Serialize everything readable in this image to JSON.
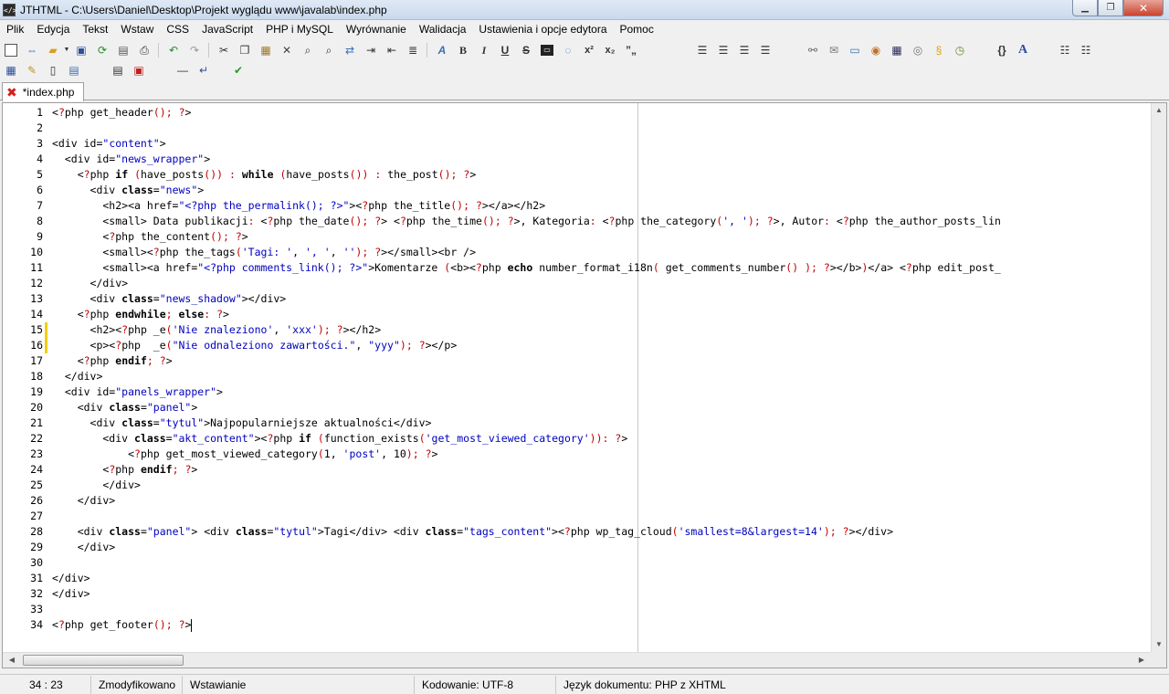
{
  "window": {
    "title": "JTHTML - C:\\Users\\Daniel\\Desktop\\Projekt wyglądu www\\javalab\\index.php",
    "app_icon_text": "</>"
  },
  "menu": [
    "Plik",
    "Edycja",
    "Tekst",
    "Wstaw",
    "CSS",
    "JavaScript",
    "PHP i MySQL",
    "Wyrównanie",
    "Walidacja",
    "Ustawienia i opcje edytora",
    "Pomoc"
  ],
  "toolbar1": {
    "file_icons": [
      "new-file-icon",
      "open-html-icon",
      "open-folder-icon",
      "save-icon",
      "save-all-icon",
      "refresh-icon",
      "print-icon"
    ],
    "undo_icons": [
      "undo-icon",
      "redo-icon"
    ],
    "edit_icons": [
      "cut-icon",
      "copy-icon",
      "paste-icon",
      "delete-icon",
      "find-icon",
      "find-next-icon",
      "replace-icon",
      "indent-icon",
      "outdent-icon",
      "comment-icon"
    ],
    "format_labels": {
      "bold": "B",
      "italic": "I",
      "underline": "U",
      "strike": "S",
      "superscript": "x²",
      "subscript": "x₂",
      "quote": "”„"
    },
    "align_icons": [
      "align-left-icon",
      "align-center-icon",
      "align-right-icon",
      "justify-icon"
    ],
    "insert_icons": [
      "link-icon",
      "email-icon",
      "image-icon",
      "palette-icon",
      "table-icon",
      "media-icon",
      "plugin-icon",
      "clock-icon"
    ],
    "braces_label": "{}",
    "font_label": "A"
  },
  "toolbar2": {
    "icons": [
      "table-grid-icon",
      "edit-table-icon",
      "frame-icon",
      "form-icon",
      "list-icon",
      "validate-icon",
      "hr-icon",
      "line-break-icon",
      "check-icon"
    ]
  },
  "tab": {
    "label": "*index.php"
  },
  "code_lines": [
    {
      "n": "1",
      "text": "<?php get_header(); ?>"
    },
    {
      "n": "2",
      "text": ""
    },
    {
      "n": "3",
      "text": "<div id=\"content\">"
    },
    {
      "n": "4",
      "text": "  <div id=\"news_wrapper\">"
    },
    {
      "n": "5",
      "text": "    <?php if (have_posts()) : while (have_posts()) : the_post(); ?>"
    },
    {
      "n": "6",
      "text": "      <div class=\"news\">"
    },
    {
      "n": "7",
      "text": "        <h2><a href=\"<?php the_permalink(); ?>\"><?php the_title(); ?></a></h2>"
    },
    {
      "n": "8",
      "text": "        <small> Data publikacji: <?php the_date(); ?> <?php the_time(); ?>, Kategoria: <?php the_category(', '); ?>, Autor: <?php the_author_posts_lin"
    },
    {
      "n": "9",
      "text": "        <?php the_content(); ?>"
    },
    {
      "n": "10",
      "text": "        <small><?php the_tags('Tagi: ', ', ', ''); ?></small><br />"
    },
    {
      "n": "11",
      "text": "        <small><a href=\"<?php comments_link(); ?>\">Komentarze (<b><?php echo number_format_i18n( get_comments_number() ); ?></b>)</a> <?php edit_post_"
    },
    {
      "n": "12",
      "text": "      </div>"
    },
    {
      "n": "13",
      "text": "      <div class=\"news_shadow\"></div>"
    },
    {
      "n": "14",
      "text": "    <?php endwhile; else: ?>"
    },
    {
      "n": "15",
      "text": "      <h2><?php _e('Nie znaleziono', 'xxx'); ?></h2>"
    },
    {
      "n": "16",
      "text": "      <p><?php  _e(\"Nie odnaleziono zawartości.\", \"yyy\"); ?></p>"
    },
    {
      "n": "17",
      "text": "    <?php endif; ?>"
    },
    {
      "n": "18",
      "text": "  </div>"
    },
    {
      "n": "19",
      "text": "  <div id=\"panels_wrapper\">"
    },
    {
      "n": "20",
      "text": "    <div class=\"panel\">"
    },
    {
      "n": "21",
      "text": "      <div class=\"tytul\">Najpopularniejsze aktualności</div>"
    },
    {
      "n": "22",
      "text": "        <div class=\"akt_content\"><?php if (function_exists('get_most_viewed_category')): ?>"
    },
    {
      "n": "23",
      "text": "            <?php get_most_viewed_category(1, 'post', 10); ?>"
    },
    {
      "n": "24",
      "text": "        <?php endif; ?>"
    },
    {
      "n": "25",
      "text": "        </div>"
    },
    {
      "n": "26",
      "text": "    </div>"
    },
    {
      "n": "27",
      "text": ""
    },
    {
      "n": "28",
      "text": "    <div class=\"panel\"> <div class=\"tytul\">Tagi</div> <div class=\"tags_content\"><?php wp_tag_cloud('smallest=8&largest=14'); ?></div>"
    },
    {
      "n": "29",
      "text": "    </div>"
    },
    {
      "n": "30",
      "text": ""
    },
    {
      "n": "31",
      "text": "</div>"
    },
    {
      "n": "32",
      "text": "</div>"
    },
    {
      "n": "33",
      "text": ""
    },
    {
      "n": "34",
      "text": "<?php get_footer(); ?>"
    }
  ],
  "modified_lines": [
    "15",
    "16"
  ],
  "status": {
    "position": "34 : 23",
    "modified": "Zmodyfikowano",
    "mode": "Wstawianie",
    "encoding": "Kodowanie: UTF-8",
    "doc_lang": "Język dokumentu: PHP z XHTML"
  },
  "colors": {
    "string": "#0000c0",
    "punct": "#c00000",
    "modified_marker": "#f0d000"
  }
}
